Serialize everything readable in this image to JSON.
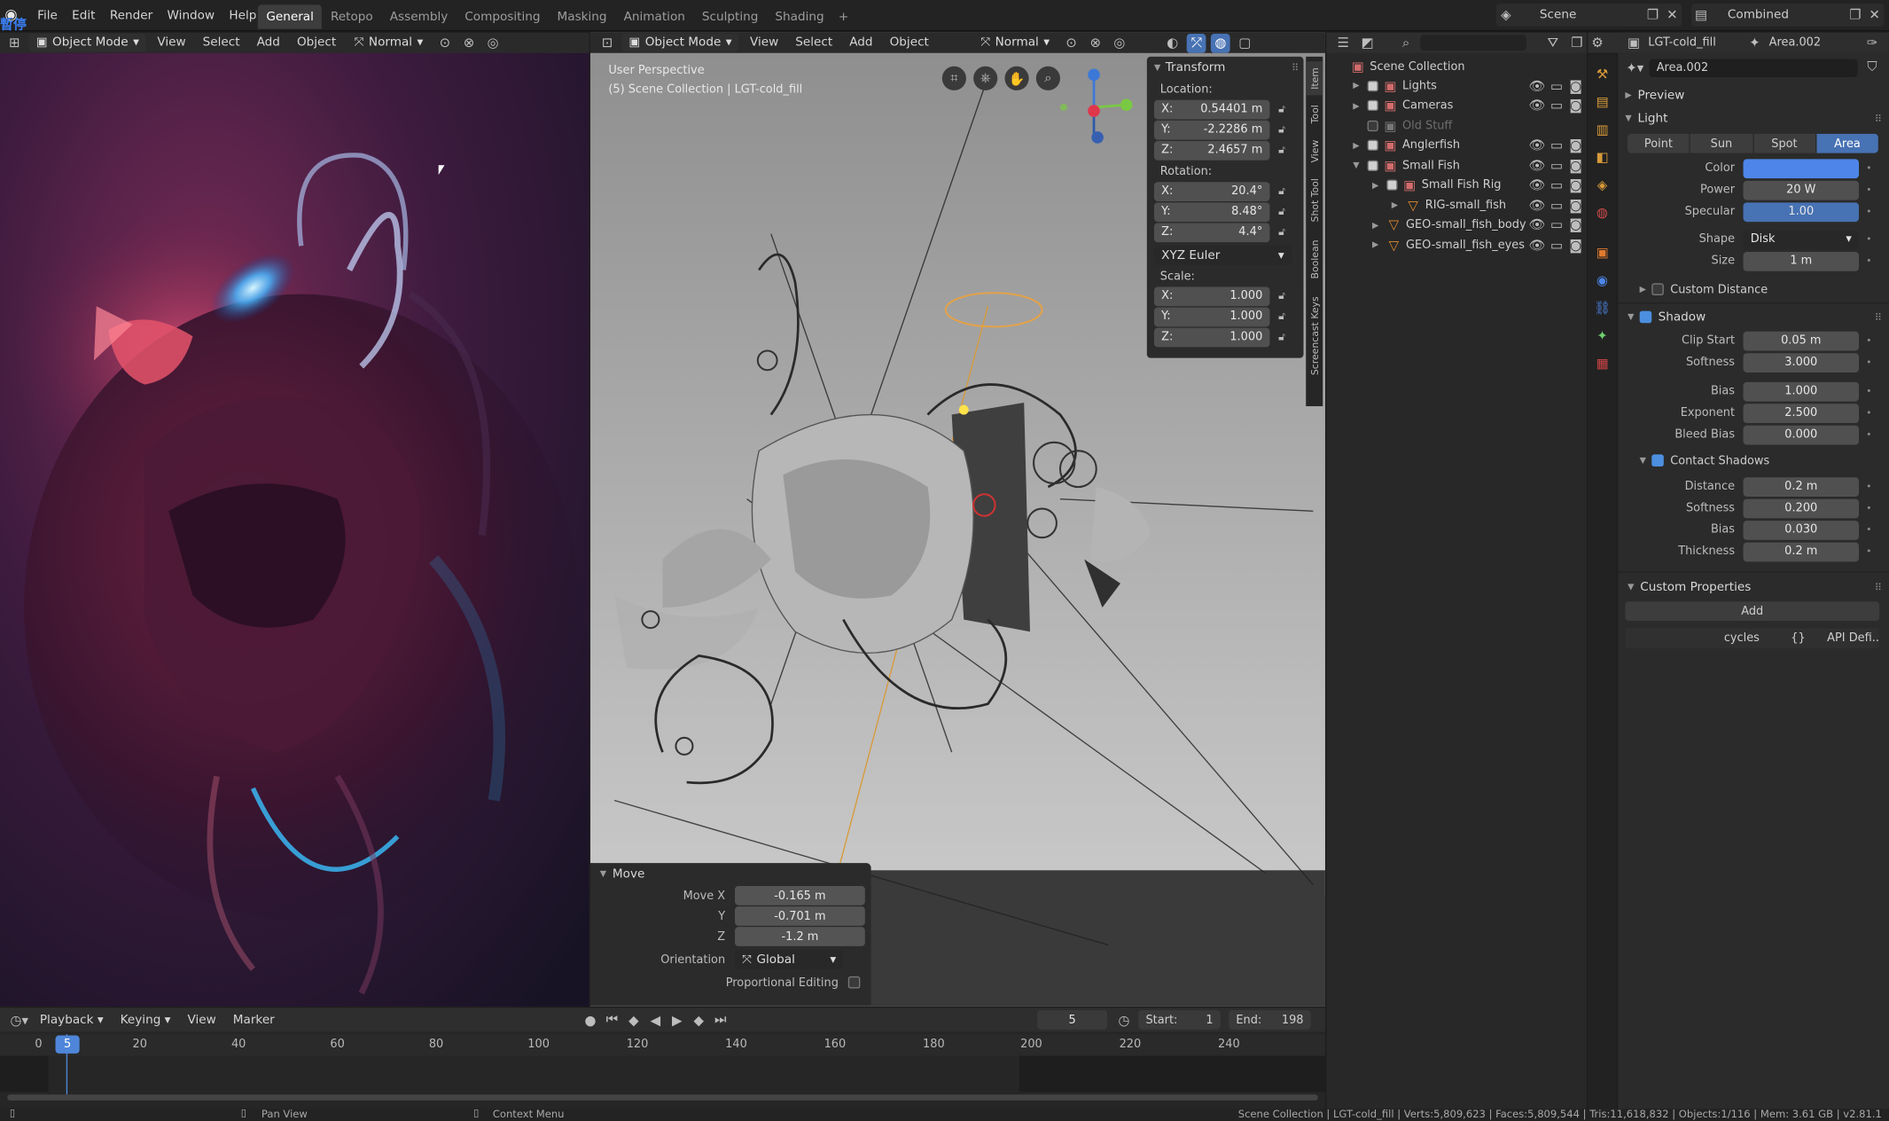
{
  "menu": {
    "logo_overlay": "暫停",
    "items": [
      "File",
      "Edit",
      "Render",
      "Window",
      "Help"
    ]
  },
  "workspaces": [
    "General",
    "Retopo",
    "Assembly",
    "Compositing",
    "Masking",
    "Animation",
    "Sculpting",
    "Shading"
  ],
  "add_tab": "+",
  "scene": {
    "name": "Scene",
    "layer": "Combined"
  },
  "left_header": {
    "mode": "Object Mode",
    "menus": [
      "View",
      "Select",
      "Add",
      "Object"
    ],
    "orientation": "Normal"
  },
  "vp_header": {
    "mode": "Object Mode",
    "menus": [
      "View",
      "Select",
      "Add",
      "Object"
    ],
    "orientation": "Normal"
  },
  "viewport": {
    "perspective": "User Perspective",
    "collection": "(5) Scene Collection | LGT-cold_fill"
  },
  "transform": {
    "title": "Transform",
    "location_label": "Location:",
    "location": [
      {
        "axis": "X:",
        "value": "0.54401 m"
      },
      {
        "axis": "Y:",
        "value": "-2.2286 m"
      },
      {
        "axis": "Z:",
        "value": "2.4657 m"
      }
    ],
    "rotation_label": "Rotation:",
    "rotation": [
      {
        "axis": "X:",
        "value": "20.4°"
      },
      {
        "axis": "Y:",
        "value": "8.48°"
      },
      {
        "axis": "Z:",
        "value": "4.4°"
      }
    ],
    "euler": "XYZ Euler",
    "scale_label": "Scale:",
    "scale": [
      {
        "axis": "X:",
        "value": "1.000"
      },
      {
        "axis": "Y:",
        "value": "1.000"
      },
      {
        "axis": "Z:",
        "value": "1.000"
      }
    ]
  },
  "side_tabs": [
    "Item",
    "Tool",
    "View",
    "Shot Tool",
    "Boolean",
    "Screencast Keys"
  ],
  "move_panel": {
    "title": "Move",
    "rows": [
      {
        "label": "Move X",
        "value": "-0.165 m"
      },
      {
        "label": "Y",
        "value": "-0.701 m"
      },
      {
        "label": "Z",
        "value": "-1.2 m"
      }
    ],
    "orientation_label": "Orientation",
    "orientation": "Global",
    "proportional": "Proportional Editing"
  },
  "outliner": {
    "root": "Scene Collection",
    "items": [
      {
        "name": "Lights",
        "indent": 0
      },
      {
        "name": "Cameras",
        "indent": 0
      },
      {
        "name": "Old Stuff",
        "indent": 0
      },
      {
        "name": "Anglerfish",
        "indent": 0
      },
      {
        "name": "Small Fish",
        "indent": 0
      },
      {
        "name": "Small Fish Rig",
        "indent": 1
      },
      {
        "name": "RIG-small_fish",
        "indent": 2
      },
      {
        "name": "GEO-small_fish_body",
        "indent": 1
      },
      {
        "name": "GEO-small_fish_eyes",
        "indent": 1
      }
    ]
  },
  "props": {
    "object": "LGT-cold_fill",
    "data": "Area.002",
    "datablock": "Area.002",
    "preview": "Preview",
    "light": "Light",
    "light_types": [
      "Point",
      "Sun",
      "Spot",
      "Area"
    ],
    "active_type": "Area",
    "color_label": "Color",
    "color": "#4d86e8",
    "power_label": "Power",
    "power": "20 W",
    "specular_label": "Specular",
    "specular": "1.00",
    "specular_fraction": 1.0,
    "shape_label": "Shape",
    "shape": "Disk",
    "size_label": "Size",
    "size": "1 m",
    "custom_distance": "Custom Distance",
    "shadow": "Shadow",
    "shadow_rows": [
      {
        "label": "Clip Start",
        "value": "0.05 m"
      },
      {
        "label": "Softness",
        "value": "3.000"
      },
      {
        "label": "Bias",
        "value": "1.000"
      },
      {
        "label": "Exponent",
        "value": "2.500"
      },
      {
        "label": "Bleed Bias",
        "value": "0.000"
      }
    ],
    "contact_shadows": "Contact Shadows",
    "contact_rows": [
      {
        "label": "Distance",
        "value": "0.2 m"
      },
      {
        "label": "Softness",
        "value": "0.200"
      },
      {
        "label": "Bias",
        "value": "0.030"
      },
      {
        "label": "Thickness",
        "value": "0.2 m"
      }
    ],
    "custom_props": "Custom Properties",
    "add": "Add",
    "cycles": "cycles",
    "braces": "{}",
    "api": "API Defi.."
  },
  "timeline": {
    "menus": [
      "Playback",
      "Keying",
      "View",
      "Marker"
    ],
    "current": "5",
    "start_label": "Start:",
    "start": "1",
    "end_label": "End:",
    "end": "198",
    "ruler": [
      "0",
      "20",
      "40",
      "60",
      "80",
      "100",
      "120",
      "140",
      "160",
      "180",
      "200",
      "220",
      "240"
    ],
    "playhead": "5"
  },
  "status": {
    "left": "Pan View",
    "mid": "Context Menu",
    "right": "Scene Collection | LGT-cold_fill | Verts:5,809,623 | Faces:5,809,544 | Tris:11,618,832 | Objects:1/116 | Mem: 3.61 GB | v2.81.1"
  }
}
